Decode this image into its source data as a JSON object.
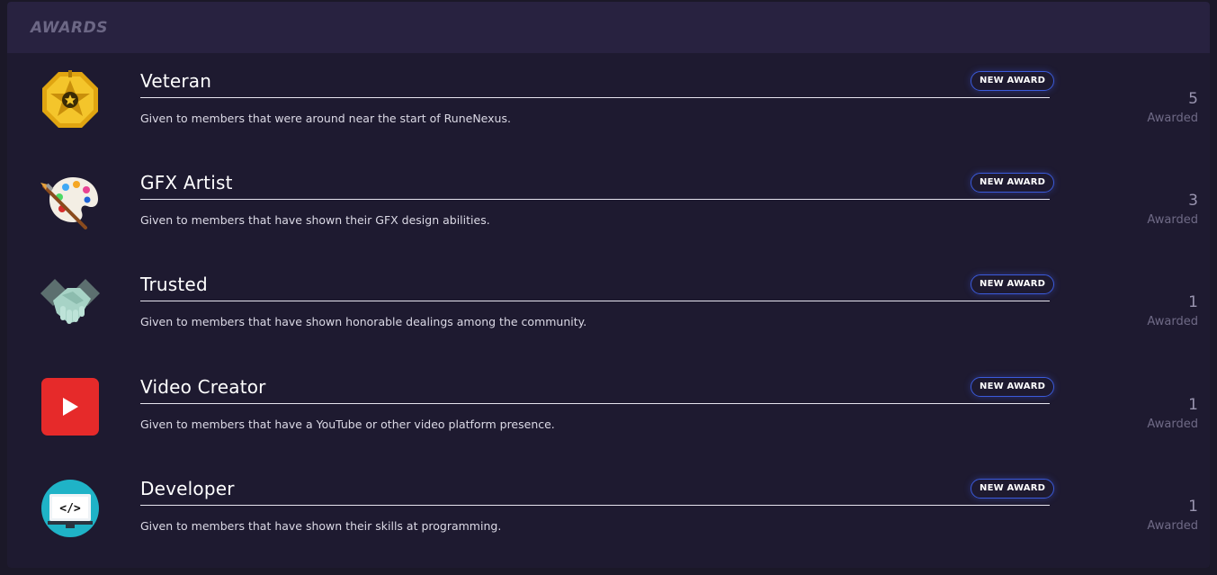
{
  "panel": {
    "title": "AWARDS"
  },
  "awards": [
    {
      "icon": "veteran-medal-icon",
      "title": "Veteran",
      "badge": "NEW AWARD",
      "description": "Given to members that were around near the start of RuneNexus.",
      "count": "5",
      "count_label": "Awarded"
    },
    {
      "icon": "paint-palette-icon",
      "title": "GFX Artist",
      "badge": "NEW AWARD",
      "description": "Given to members that have shown their GFX design abilities.",
      "count": "3",
      "count_label": "Awarded"
    },
    {
      "icon": "handshake-icon",
      "title": "Trusted",
      "badge": "NEW AWARD",
      "description": "Given to members that have shown honorable dealings among the community.",
      "count": "1",
      "count_label": "Awarded"
    },
    {
      "icon": "youtube-play-icon",
      "title": "Video Creator",
      "badge": "NEW AWARD",
      "description": "Given to members that have a YouTube or other video platform presence.",
      "count": "1",
      "count_label": "Awarded"
    },
    {
      "icon": "code-monitor-icon",
      "title": "Developer",
      "badge": "NEW AWARD",
      "description": "Given to members that have shown their skills at programming.",
      "count": "1",
      "count_label": "Awarded"
    }
  ],
  "colors": {
    "background": "#1e1a30",
    "header": "#282240",
    "badge_border": "#3b5bdb",
    "youtube_red": "#e62a2a",
    "developer_teal": "#1fb3c7",
    "medal_gold": "#f2c021"
  }
}
